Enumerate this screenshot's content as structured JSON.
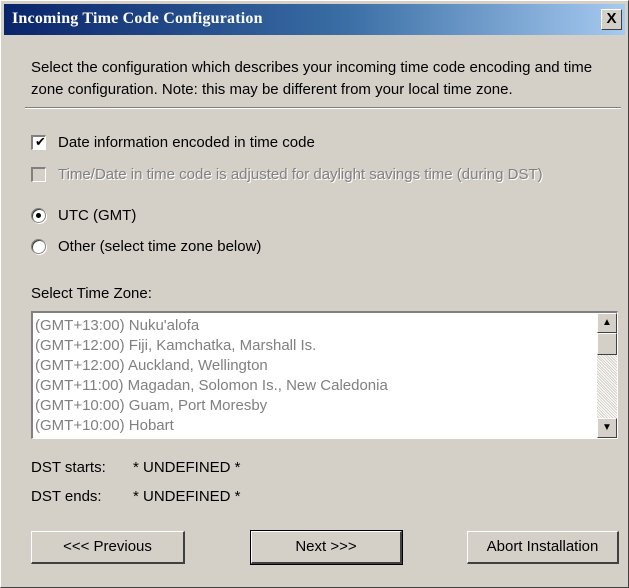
{
  "window": {
    "title": "Incoming Time Code Configuration",
    "close_label": "X"
  },
  "description": "Select the configuration which describes your incoming time code encoding and time zone configuration.  Note: this may be different from your local time zone.",
  "options": {
    "date_encoded": {
      "label": "Date information encoded in time code",
      "checked": true,
      "enabled": true
    },
    "dst_adjusted": {
      "label": "Time/Date in time code is adjusted for daylight savings time (during DST)",
      "checked": false,
      "enabled": false
    },
    "utc": {
      "label": "UTC (GMT)",
      "selected": true
    },
    "other": {
      "label": "Other (select time zone below)",
      "selected": false
    }
  },
  "time_zone": {
    "label": "Select Time Zone:",
    "items": [
      "(GMT+13:00) Nuku'alofa",
      "(GMT+12:00) Fiji, Kamchatka, Marshall Is.",
      "(GMT+12:00) Auckland, Wellington",
      "(GMT+11:00) Magadan, Solomon Is., New Caledonia",
      "(GMT+10:00) Guam, Port Moresby",
      "(GMT+10:00) Hobart"
    ]
  },
  "dst": {
    "starts_label": "DST starts:",
    "starts_value": "* UNDEFINED *",
    "ends_label": "DST ends:",
    "ends_value": "* UNDEFINED *"
  },
  "buttons": {
    "previous": "<<< Previous",
    "next": "Next >>>",
    "abort": "Abort Installation"
  },
  "scrollbar": {
    "up_glyph": "▲",
    "down_glyph": "▼"
  },
  "checkbox_tick": "✔"
}
